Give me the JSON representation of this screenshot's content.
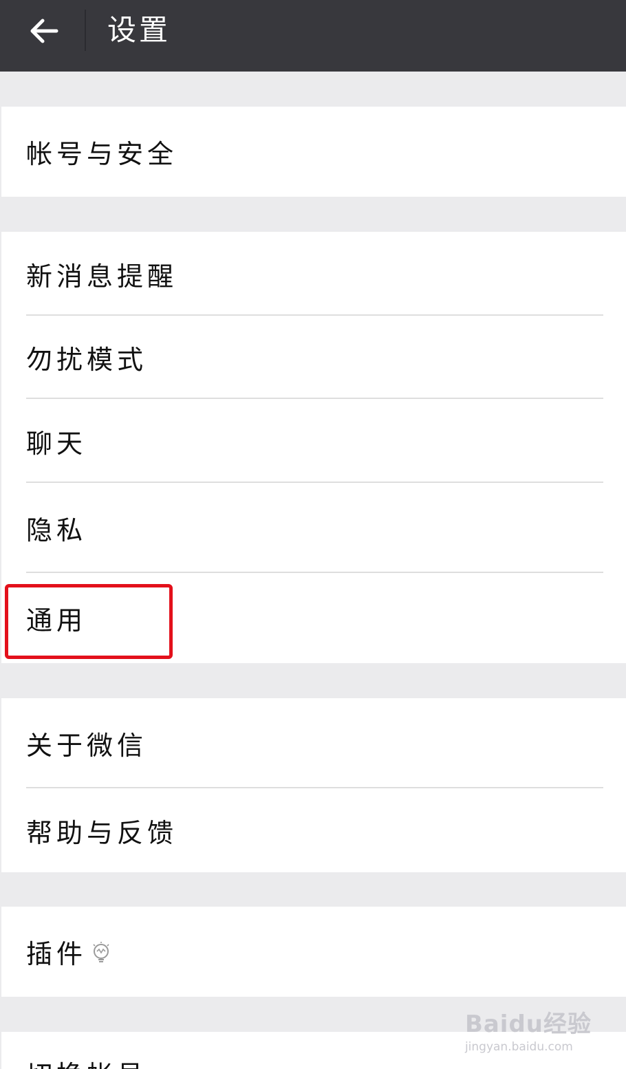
{
  "header": {
    "title": "设置",
    "back_icon": "arrow-left-icon"
  },
  "groups": [
    {
      "items": [
        {
          "label": "帐号与安全"
        }
      ]
    },
    {
      "items": [
        {
          "label": "新消息提醒"
        },
        {
          "label": "勿扰模式"
        },
        {
          "label": "聊天"
        },
        {
          "label": "隐私"
        },
        {
          "label": "通用"
        }
      ]
    },
    {
      "items": [
        {
          "label": "关于微信"
        },
        {
          "label": "帮助与反馈"
        }
      ]
    },
    {
      "items": [
        {
          "label": "插件",
          "icon": "lightbulb-icon"
        }
      ]
    },
    {
      "items": [
        {
          "label": "切换帐号"
        }
      ]
    }
  ],
  "highlight": {
    "target": "通用",
    "color": "#e3101b"
  },
  "colors": {
    "header_bg": "#38383d",
    "page_bg": "#ebebed",
    "row_bg": "#ffffff"
  },
  "watermark": {
    "brand": "Baidu经验",
    "url": "jingyan.baidu.com"
  }
}
